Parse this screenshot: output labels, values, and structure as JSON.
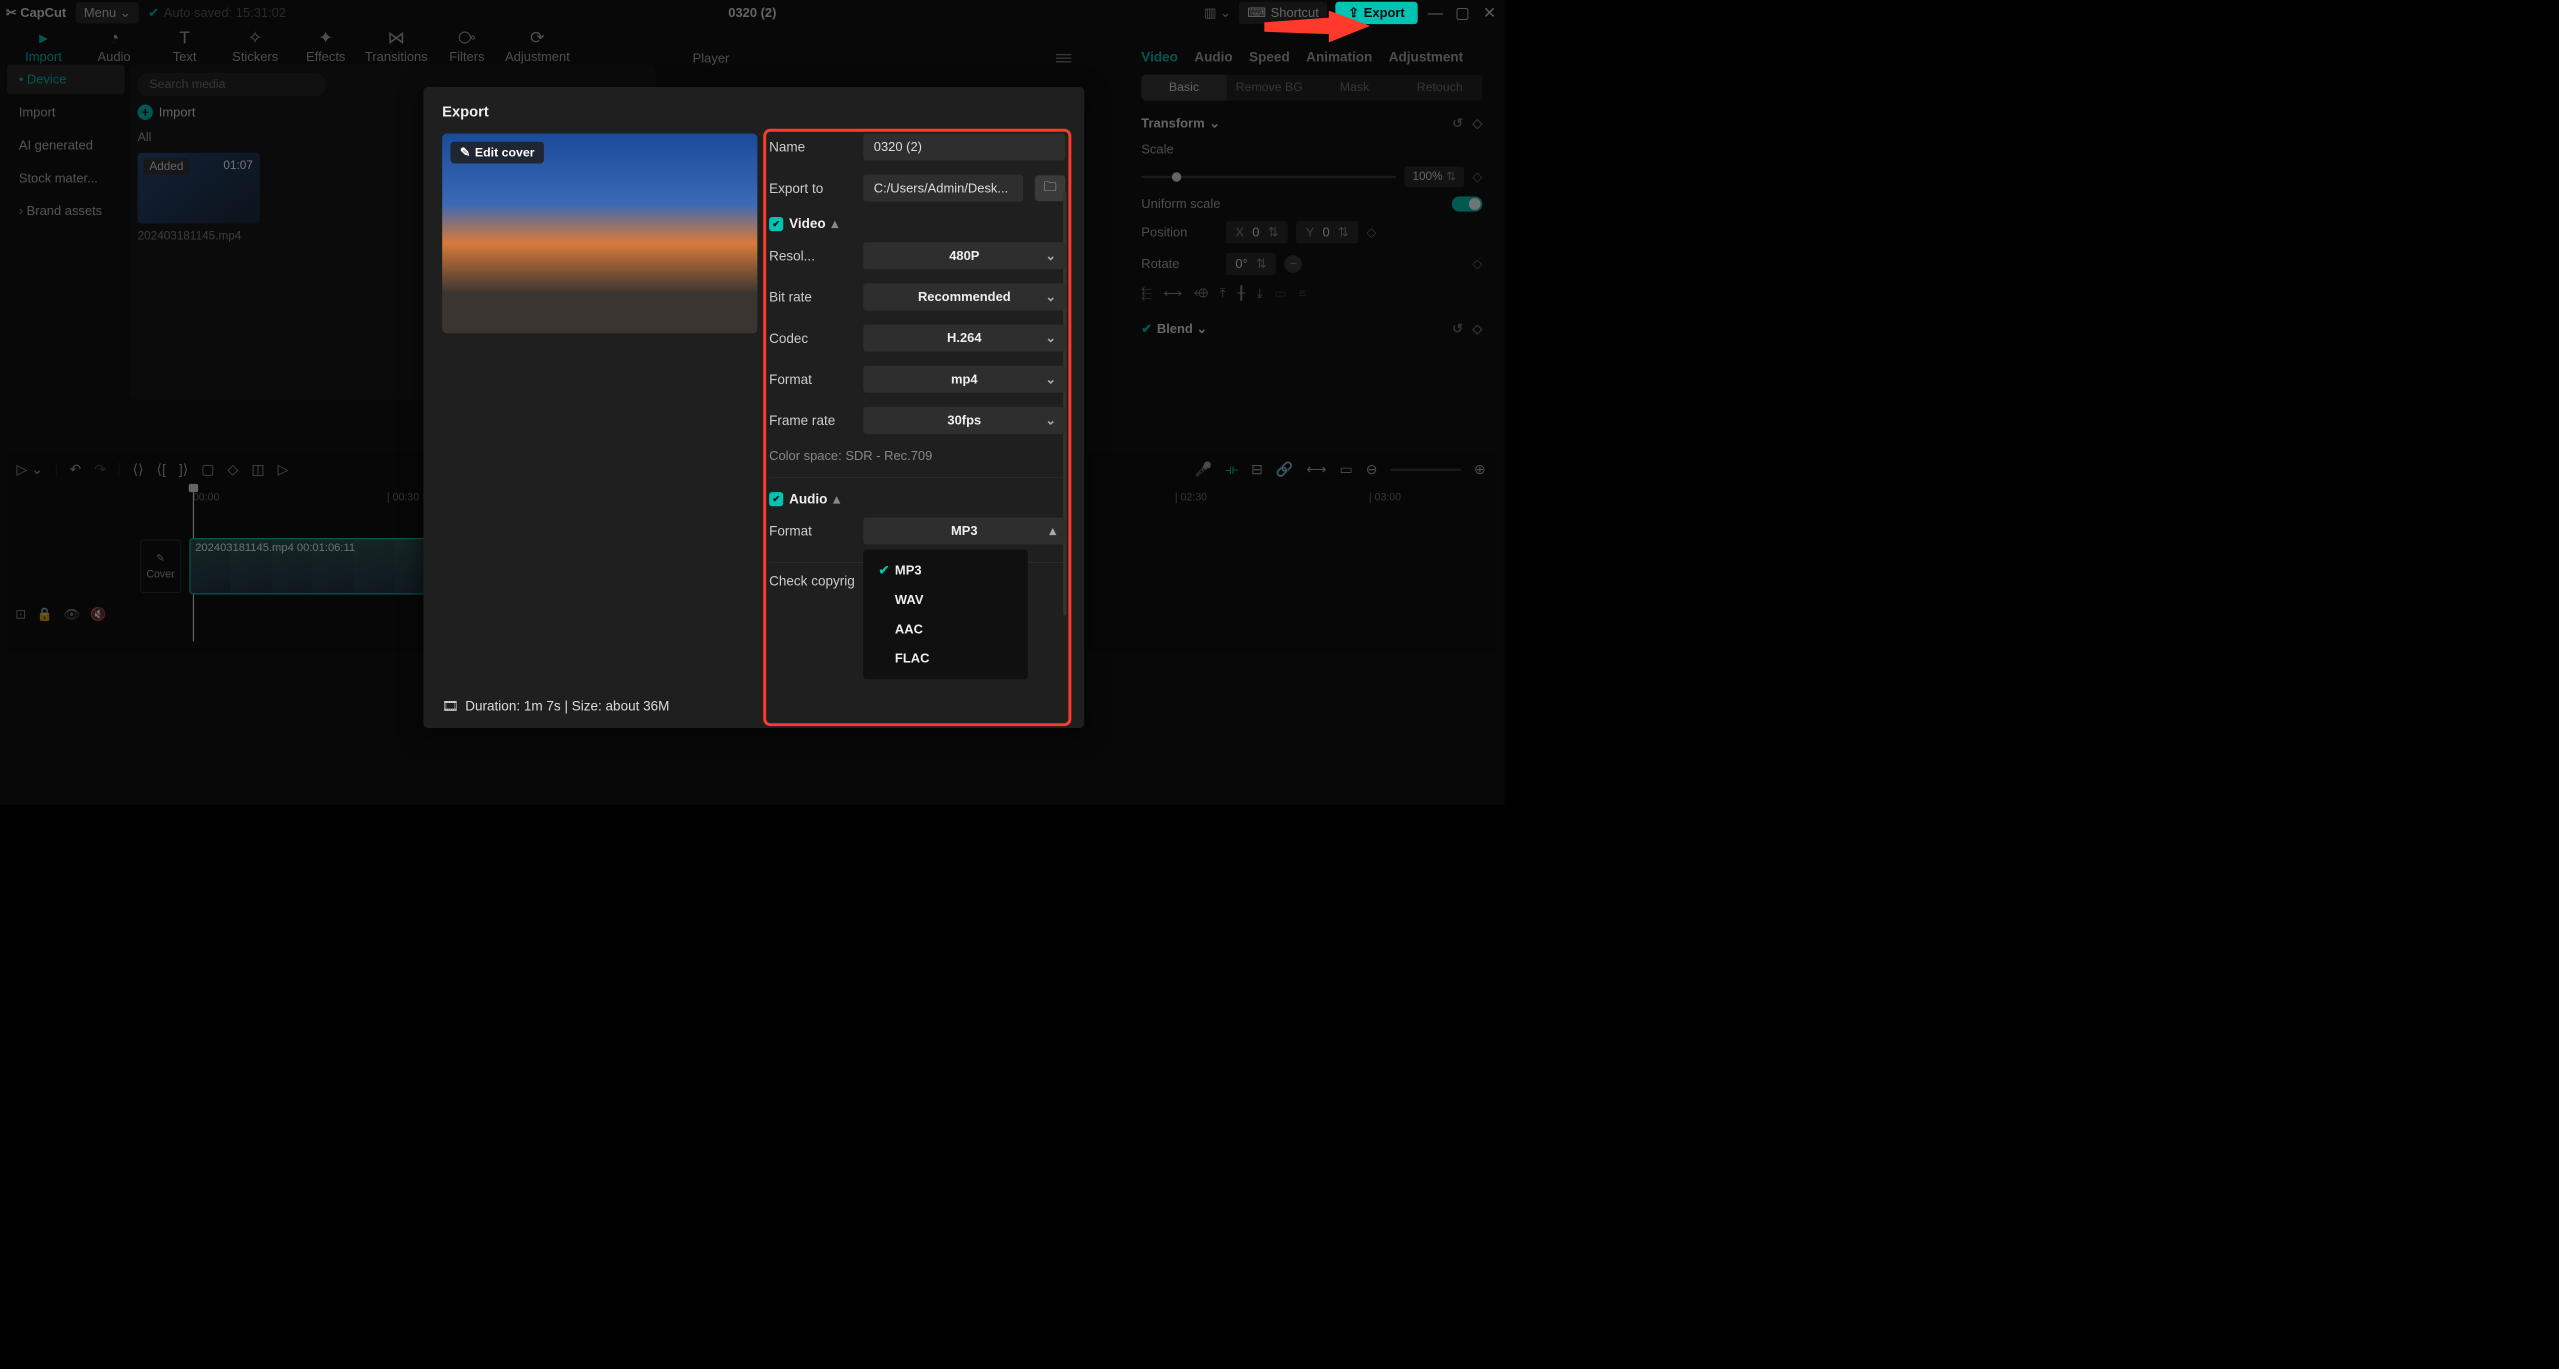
{
  "topbar": {
    "app": "CapCut",
    "menu": "Menu",
    "autosave": "Auto saved: 15:31:02",
    "project_title": "0320 (2)",
    "shortcut": "Shortcut",
    "export": "Export",
    "win_min": "—",
    "win_max": "▢",
    "win_close": "✕"
  },
  "tabs": [
    "Import",
    "Audio",
    "Text",
    "Stickers",
    "Effects",
    "Transitions",
    "Filters",
    "Adjustment"
  ],
  "sidebar": {
    "items": [
      "Device",
      "Import",
      "AI generated",
      "Stock mater...",
      "Brand assets"
    ]
  },
  "media": {
    "search_ph": "Search media",
    "import": "Import",
    "all": "All",
    "thumb_label": "Added",
    "thumb_time": "01:07",
    "thumb_name": "20240318​1145.mp4"
  },
  "player": {
    "label": "Player"
  },
  "inspector": {
    "tabs": [
      "Video",
      "Audio",
      "Speed",
      "Animation",
      "Adjustment"
    ],
    "subtabs": [
      "Basic",
      "Remove BG",
      "Mask",
      "Retouch"
    ],
    "transform": "Transform",
    "scale": "Scale",
    "scale_val": "100%",
    "uniform": "Uniform scale",
    "position": "Position",
    "pos_x": "0",
    "pos_y": "0",
    "rotate": "Rotate",
    "rotate_val": "0°",
    "blend": "Blend"
  },
  "timeline": {
    "t0": "00:00",
    "t1": "| 00:30",
    "t2": "| 02:30",
    "t3": "| 03:00",
    "cover": "Cover",
    "clip": "20240318​1145.mp4   00:01:06:11"
  },
  "modal": {
    "title": "Export",
    "name_lbl": "Name",
    "name_val": "0320 (2)",
    "exportto_lbl": "Export to",
    "exportto_val": "C:/Users/Admin/Desk...",
    "video_hdr": "Video",
    "resolution_lbl": "Resol...",
    "resolution_val": "480P",
    "bitrate_lbl": "Bit rate",
    "bitrate_val": "Recommended",
    "codec_lbl": "Codec",
    "codec_val": "H.264",
    "format_lbl": "Format",
    "format_val": "mp4",
    "fps_lbl": "Frame rate",
    "fps_val": "30fps",
    "colorspace": "Color space: SDR - Rec.709",
    "audio_hdr": "Audio",
    "aformat_lbl": "Format",
    "aformat_val": "MP3",
    "dd_options": [
      "MP3",
      "WAV",
      "AAC",
      "FLAC"
    ],
    "copyright": "Check copyrig",
    "edit_cover": "Edit cover",
    "duration": "Duration: 1m 7s | Size: about 36M"
  }
}
